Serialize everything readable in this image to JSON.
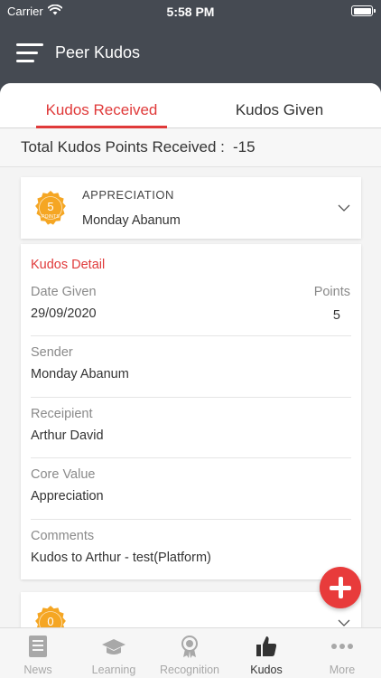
{
  "status_bar": {
    "carrier": "Carrier",
    "time": "5:58 PM"
  },
  "header": {
    "title": "Peer Kudos"
  },
  "tabs": [
    {
      "label": "Kudos Received",
      "active": true
    },
    {
      "label": "Kudos Given",
      "active": false
    }
  ],
  "summary": {
    "label": "Total Kudos Points Received :",
    "value": "-15"
  },
  "kudos_list": [
    {
      "badge_points": "5",
      "badge_caption": "POINTS",
      "category": "APPRECIATION",
      "name": "Monday Abanum",
      "expanded": true,
      "detail": {
        "title": "Kudos Detail",
        "date_label": "Date Given",
        "date": "29/09/2020",
        "points_label": "Points",
        "points": "5",
        "sender_label": "Sender",
        "sender": "Monday Abanum",
        "recipient_label": "Receipient",
        "recipient": "Arthur David",
        "core_value_label": "Core Value",
        "core_value": "Appreciation",
        "comments_label": "Comments",
        "comments": "Kudos to Arthur - test(Platform)"
      }
    },
    {
      "badge_points": "0",
      "expanded": false
    }
  ],
  "tab_bar": [
    {
      "label": "News",
      "icon": "news-icon",
      "active": false
    },
    {
      "label": "Learning",
      "icon": "graduation-cap-icon",
      "active": false
    },
    {
      "label": "Recognition",
      "icon": "award-medal-icon",
      "active": false
    },
    {
      "label": "Kudos",
      "icon": "thumbs-up-icon",
      "active": true
    },
    {
      "label": "More",
      "icon": "more-dots-icon",
      "active": false
    }
  ],
  "colors": {
    "header_bg": "#454a52",
    "accent_red": "#e03a3a",
    "badge_orange": "#f5a623",
    "fab_red": "#e83b3b"
  }
}
